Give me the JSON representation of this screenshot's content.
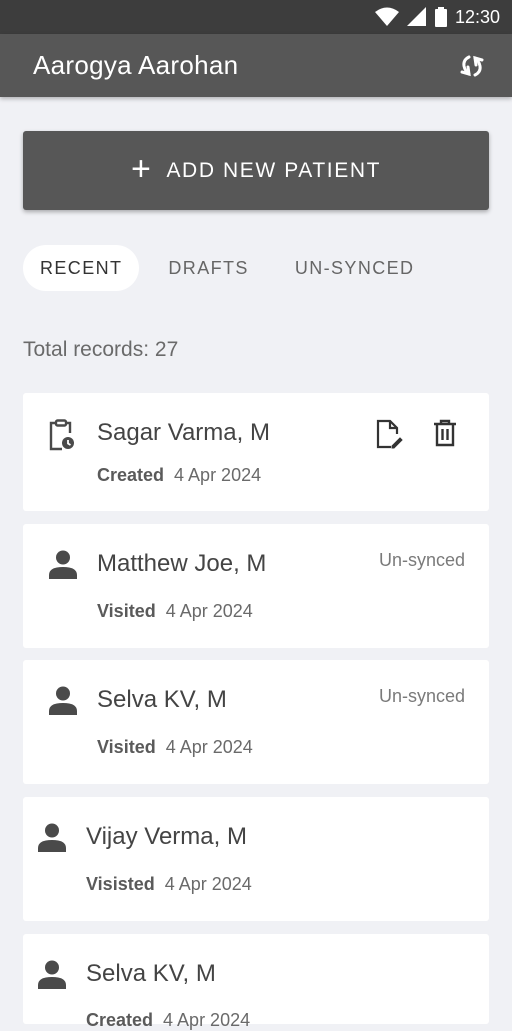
{
  "status_bar": {
    "time": "12:30"
  },
  "app_bar": {
    "title": "Aarogya Aarohan"
  },
  "add_button": {
    "icon": "+",
    "label": "ADD NEW PATIENT"
  },
  "tabs": [
    {
      "label": "RECENT"
    },
    {
      "label": "DRAFTS"
    },
    {
      "label": "UN-SYNCED"
    }
  ],
  "total_records": "Total records: 27",
  "records": [
    {
      "name": "Sagar Varma, M",
      "meta_label": "Created",
      "date": "4 Apr 2024"
    },
    {
      "name": "Matthew Joe, M",
      "meta_label": "Visited",
      "date": "4 Apr 2024",
      "badge": "Un-synced"
    },
    {
      "name": "Selva KV, M",
      "meta_label": "Visited",
      "date": "4 Apr 2024",
      "badge": "Un-synced"
    },
    {
      "name": "Vijay Verma, M",
      "meta_label": "Visisted",
      "date": "4 Apr 2024"
    },
    {
      "name": "Selva KV, M",
      "meta_label": "Created",
      "date": "4 Apr 2024"
    }
  ]
}
